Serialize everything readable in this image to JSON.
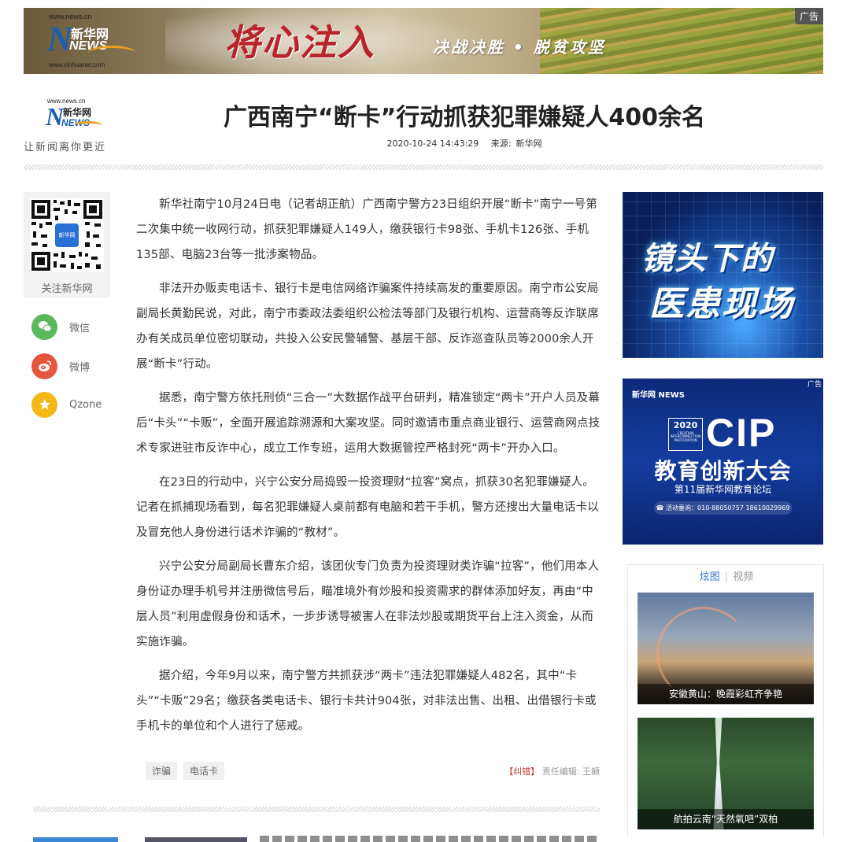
{
  "banner": {
    "logo_url": "www.news.cn",
    "logo_brand_cn": "新华网",
    "logo_brand_en": "NEWS",
    "logo_sub_url": "www.xinhuanet.com",
    "calligraphy": "将心注入",
    "slogan": "决战决胜 • 脱贫攻坚",
    "ad_label": "广告"
  },
  "header": {
    "logo_url": "www.news.cn",
    "logo_brand_cn": "新华网",
    "logo_brand_en": "NEWS",
    "tagline": "让新闻离你更近",
    "title": "广西南宁“断卡”行动抓获犯罪嫌疑人400余名",
    "datetime": "2020-10-24 14:43:29",
    "source_label": "来源:",
    "source_value": "新华网"
  },
  "share": {
    "qr_badge": "新华网",
    "qr_label": "关注新华网",
    "items": [
      {
        "label": "微信",
        "icon": "wechat-icon",
        "color": "#5cb85c"
      },
      {
        "label": "微博",
        "icon": "weibo-icon",
        "color": "#e8553e"
      },
      {
        "label": "Qzone",
        "icon": "qzone-star-icon",
        "color": "#f5b819"
      }
    ]
  },
  "article": {
    "paragraphs": [
      "新华社南宁10月24日电（记者胡正航）广西南宁警方23日组织开展“断卡”南宁一号第二次集中统一收网行动，抓获犯罪嫌疑人149人，缴获银行卡98张、手机卡126张、手机135部、电脑23台等一批涉案物品。",
      "非法开办贩卖电话卡、银行卡是电信网络诈骗案件持续高发的重要原因。南宁市公安局副局长黄勤民说，对此，南宁市委政法委组织公检法等部门及银行机构、运营商等反诈联席办有关成员单位密切联动，共投入公安民警辅警、基层干部、反诈巡查队员等2000余人开展“断卡”行动。",
      "据悉，南宁警方依托刑侦“三合一”大数据作战平台研判，精准锁定“两卡”开户人员及幕后“卡头”“卡贩”，全面开展追踪溯源和大案攻坚。同时邀请市重点商业银行、运营商网点技术专家进驻市反诈中心，成立工作专班，运用大数据管控严格封死“两卡”开办入口。",
      "在23日的行动中，兴宁公安分局捣毁一投资理财“拉客”窝点，抓获30名犯罪嫌疑人。记者在抓捕现场看到，每名犯罪嫌疑人桌前都有电脑和若干手机，警方还搜出大量电话卡以及冒充他人身份进行话术诈骗的“教材”。",
      "兴宁公安分局副局长曹东介绍，该团伙专门负责为投资理财类诈骗“拉客”，他们用本人身份证办理手机号并注册微信号后，瞄准境外有炒股和投资需求的群体添加好友，再由“中层人员”利用虚假身份和话术，一步步诱导被害人在非法炒股或期货平台上注入资金，从而实施诈骗。",
      "据介绍，今年9月以来，南宁警方共抓获涉“两卡”违法犯罪嫌疑人482名，其中“卡头”“卡贩”29名；缴获各类电话卡、银行卡共计904张，对非法出售、出租、出借银行卡或手机卡的单位和个人进行了惩戒。"
    ],
    "tags": [
      "诈骗",
      "电话卡"
    ],
    "correction_label": "【纠错】",
    "editor_label": "责任编辑:",
    "editor_name": "王頔"
  },
  "sidebar": {
    "promo1_line1": "镜头下的",
    "promo1_line2": "医患现场",
    "promo2_logo": "新华网 NEWS",
    "promo2_ad": "广告",
    "promo2_year": "2020",
    "promo2_year_sub": "CREATION INTERCONNECTION PARTICIPATION",
    "promo2_cip": "CIP",
    "promo2_main": "教育创新大会",
    "promo2_sub": "第11届新华网教育论坛",
    "promo2_contact": "☎ 活动垂询：010-88050757  18610029969",
    "gallery_tab_active": "炫图",
    "gallery_tab_inactive": "视频",
    "gallery": [
      {
        "caption": "安徽黄山：晚霞彩虹齐争艳"
      },
      {
        "caption": "航拍云南“天然氧吧”双柏"
      }
    ]
  }
}
